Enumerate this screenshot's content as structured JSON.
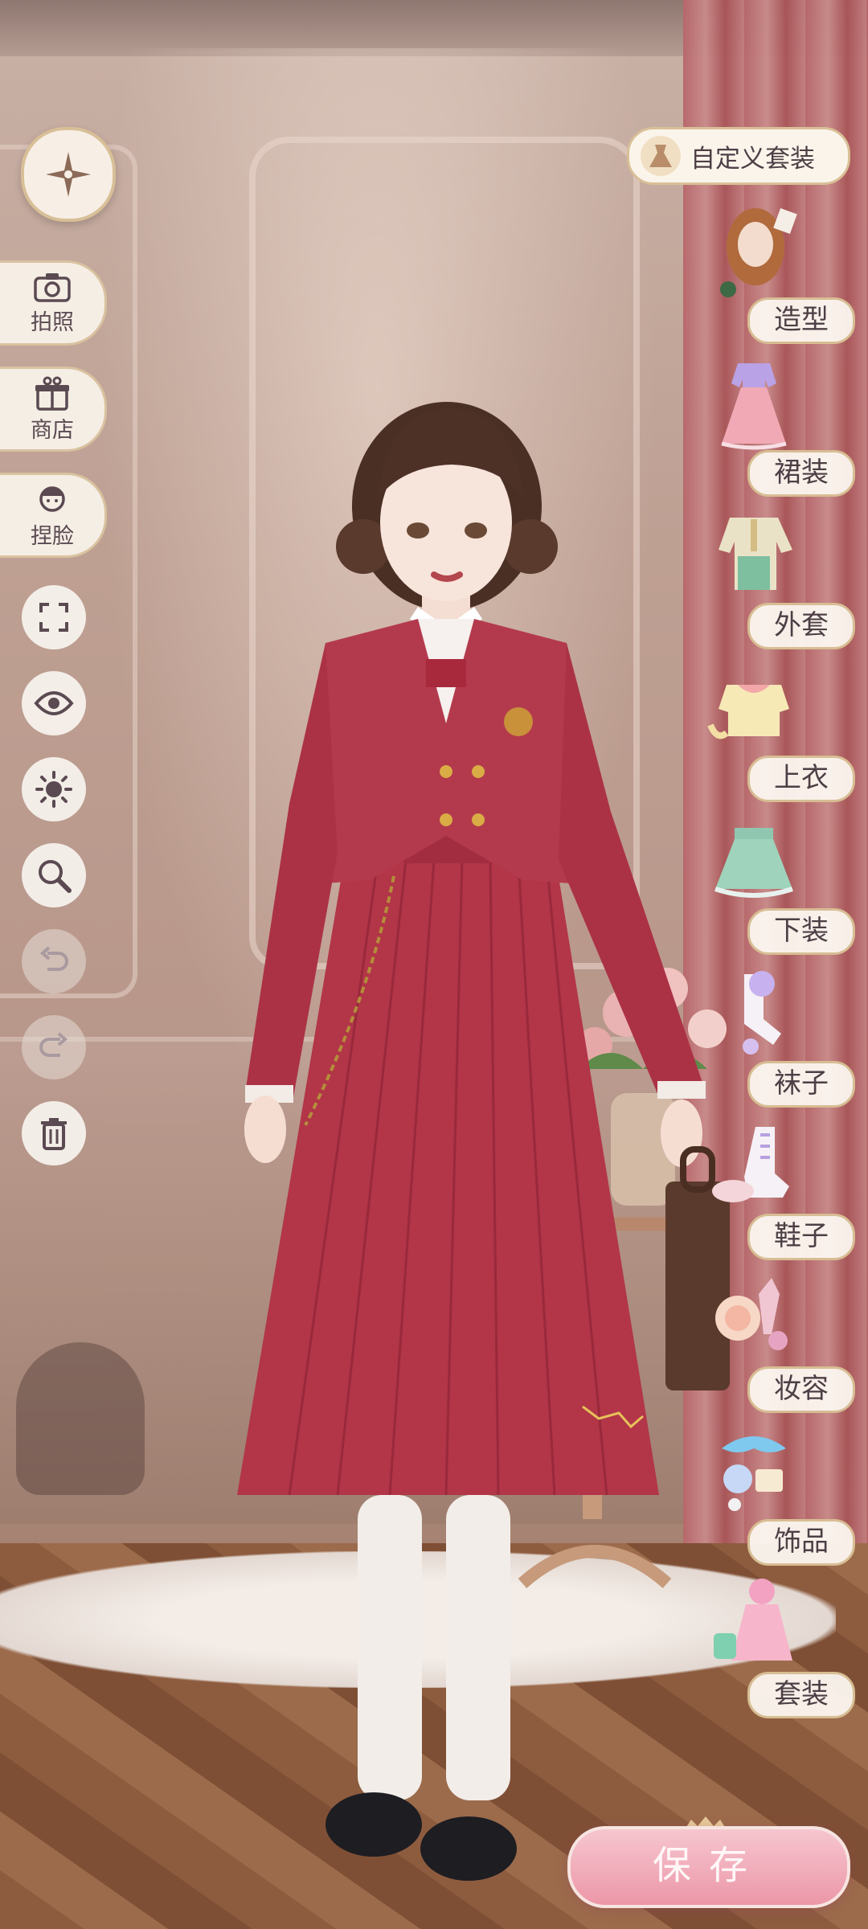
{
  "left_toolbar": {
    "camera_label": "拍照",
    "shop_label": "商店",
    "face_label": "捏脸"
  },
  "right_panel": {
    "custom_outfit_label": "自定义套装",
    "categories": [
      {
        "label": "造型",
        "icon": "hairstyle-icon"
      },
      {
        "label": "裙装",
        "icon": "dress-icon"
      },
      {
        "label": "外套",
        "icon": "coat-icon"
      },
      {
        "label": "上衣",
        "icon": "top-icon"
      },
      {
        "label": "下装",
        "icon": "skirt-icon"
      },
      {
        "label": "袜子",
        "icon": "socks-icon"
      },
      {
        "label": "鞋子",
        "icon": "shoes-icon"
      },
      {
        "label": "妆容",
        "icon": "makeup-icon"
      },
      {
        "label": "饰品",
        "icon": "accessory-icon"
      },
      {
        "label": "套装",
        "icon": "suit-icon"
      }
    ]
  },
  "save_label": "保存",
  "colors": {
    "pill_bg": "#fbf4ea",
    "gold_border": "#d8bf97",
    "save_pink": "#ec97a8",
    "uniform_red": "#b33a4c"
  }
}
